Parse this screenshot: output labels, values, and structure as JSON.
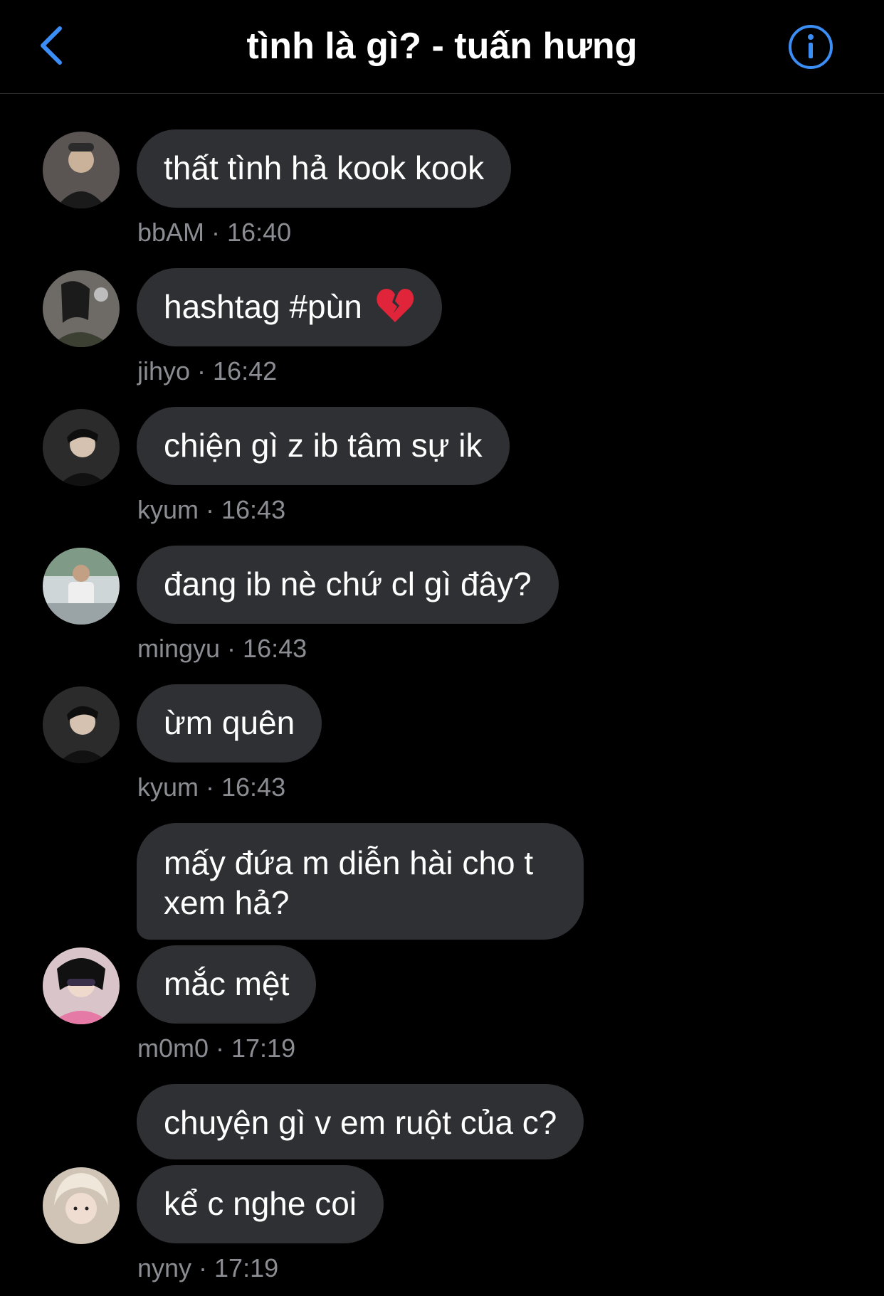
{
  "header": {
    "title": "tình là gì? - tuấn hưng",
    "accent": "#3a8ef6"
  },
  "messages": [
    {
      "text": "thất tình hả kook kook",
      "author": "bbAM",
      "time": "16:40",
      "meta": "bbAM · 16:40"
    },
    {
      "text": "hashtag #pùn",
      "emoji": "broken-heart-icon",
      "author": "jihyo",
      "time": "16:42",
      "meta": "jihyo · 16:42"
    },
    {
      "text": "chiện gì z ib tâm sự ik",
      "author": "kyum",
      "time": "16:43",
      "meta": "kyum · 16:43"
    },
    {
      "text": "đang ib nè chứ cl gì đây?",
      "author": "mingyu",
      "time": "16:43",
      "meta": "mingyu · 16:43"
    },
    {
      "text": "ừm quên",
      "author": "kyum",
      "time": "16:43",
      "meta": "kyum · 16:43"
    },
    {
      "text": "mấy đứa m diễn hài cho t xem hả?",
      "author": "m0m0",
      "time": "17:19"
    },
    {
      "text": "mắc mệt",
      "author": "m0m0",
      "time": "17:19",
      "meta": "m0m0 · 17:19"
    },
    {
      "text": "chuyện gì v em ruột của c?",
      "author": "nyny",
      "time": "17:19"
    },
    {
      "text": "kể c nghe coi",
      "author": "nyny",
      "time": "17:19",
      "meta": "nyny · 17:19"
    }
  ]
}
